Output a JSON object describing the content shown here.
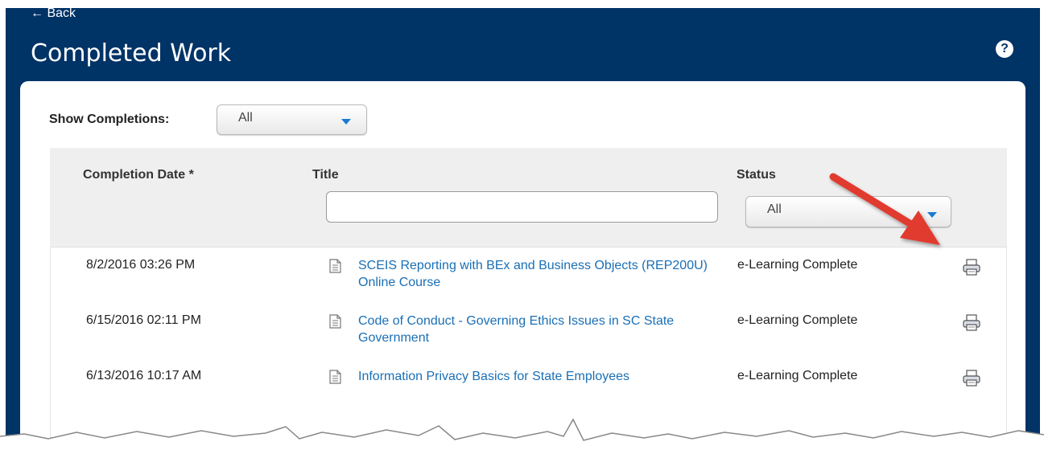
{
  "header": {
    "back_label": "← Back",
    "title": "Completed Work",
    "help_icon": "help-icon"
  },
  "filter": {
    "label": "Show Completions:",
    "value": "All"
  },
  "table": {
    "columns": {
      "date": "Completion Date *",
      "title": "Title",
      "status": "Status"
    },
    "title_filter_value": "",
    "status_filter_value": "All",
    "rows": [
      {
        "date": "8/2/2016 03:26 PM",
        "title": "SCEIS Reporting with BEx and Business Objects (REP200U) Online Course",
        "status": "e-Learning Complete"
      },
      {
        "date": "6/15/2016 02:11 PM",
        "title": "Code of Conduct - Governing Ethics Issues in SC State Government",
        "status": "e-Learning Complete"
      },
      {
        "date": "6/13/2016 10:17 AM",
        "title": "Information Privacy Basics for State Employees",
        "status": "e-Learning Complete"
      }
    ]
  },
  "colors": {
    "header_bg": "#003366",
    "link": "#1a6fb5",
    "caret": "#1a7bd1",
    "annotation_arrow": "#e03a2f"
  }
}
